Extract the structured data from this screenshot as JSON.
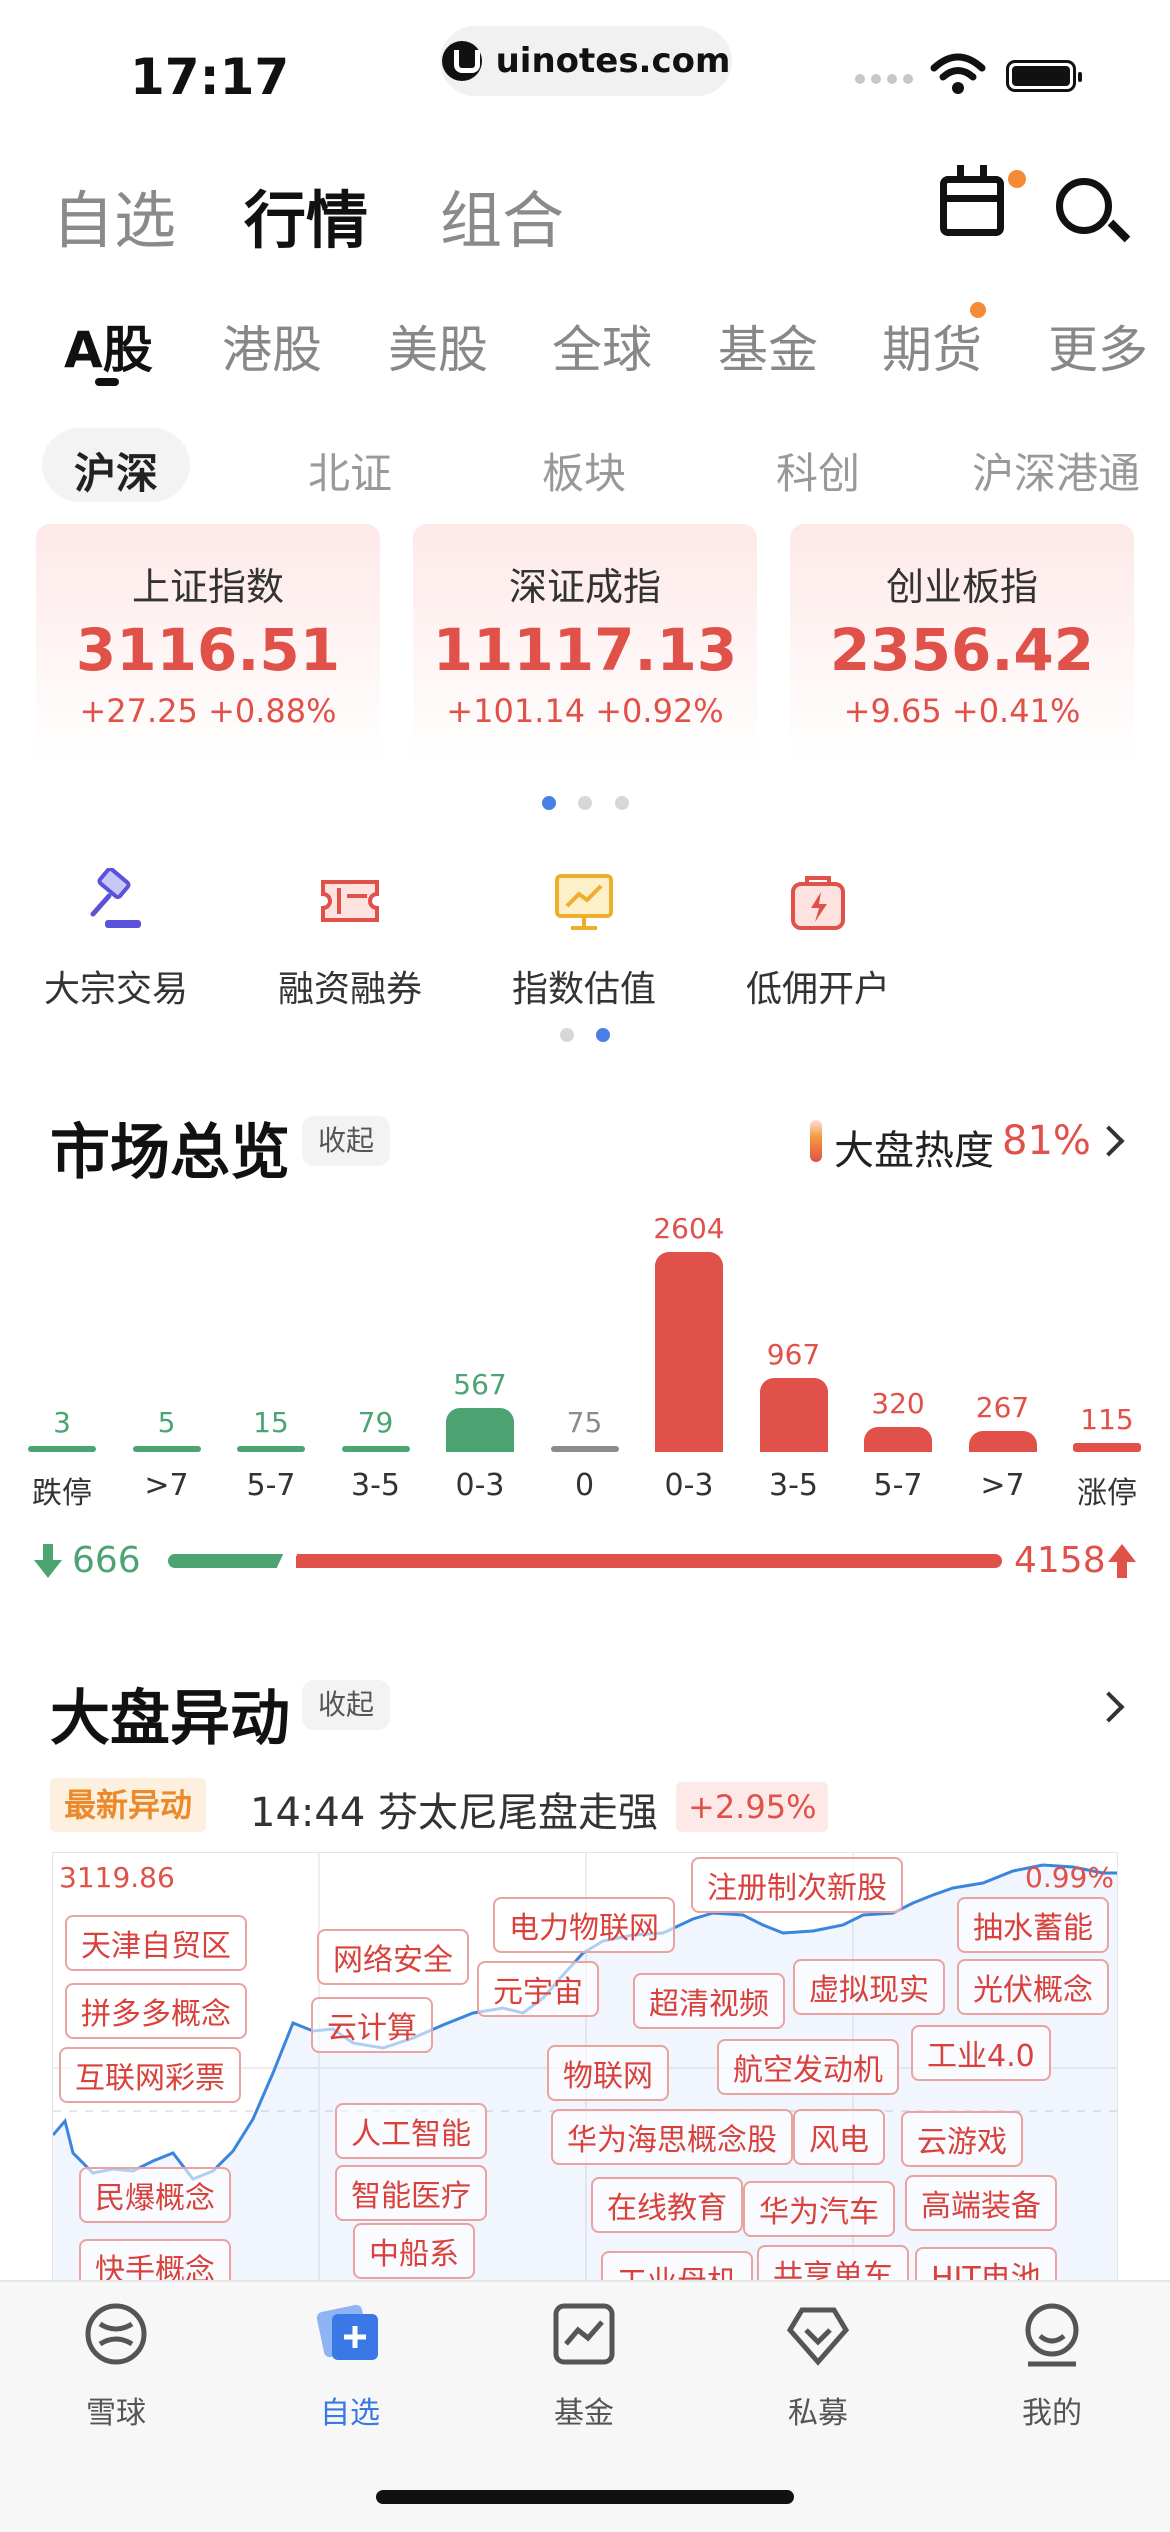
{
  "status_bar": {
    "time": "17:17",
    "url": "uinotes.com"
  },
  "top_tabs": [
    {
      "label": "自选",
      "active": false
    },
    {
      "label": "行情",
      "active": true
    },
    {
      "label": "组合",
      "active": false
    }
  ],
  "market_tabs": [
    {
      "label": "A股",
      "active": true
    },
    {
      "label": "港股"
    },
    {
      "label": "美股"
    },
    {
      "label": "全球"
    },
    {
      "label": "基金"
    },
    {
      "label": "期货",
      "badge": true
    },
    {
      "label": "更多"
    }
  ],
  "sub_tabs": [
    {
      "label": "沪深",
      "active": true
    },
    {
      "label": "北证"
    },
    {
      "label": "板块"
    },
    {
      "label": "科创"
    },
    {
      "label": "沪深港通"
    }
  ],
  "index_cards": [
    {
      "name": "上证指数",
      "value": "3116.51",
      "change": "+27.25 +0.88%"
    },
    {
      "name": "深证成指",
      "value": "11117.13",
      "change": "+101.14 +0.92%"
    },
    {
      "name": "创业板指",
      "value": "2356.42",
      "change": "+9.65 +0.41%"
    }
  ],
  "tools": [
    {
      "label": "大宗交易",
      "icon": "auction-hammer-icon"
    },
    {
      "label": "融资融券",
      "icon": "ticket-icon"
    },
    {
      "label": "指数估值",
      "icon": "chart-board-icon"
    },
    {
      "label": "低佣开户",
      "icon": "lightning-bag-icon"
    }
  ],
  "overview": {
    "title": "市场总览",
    "fold_label": "收起",
    "heat_label": "大盘热度",
    "heat_value": "81%",
    "down_count": "666",
    "up_count": "4158",
    "up_ratio": 0.862
  },
  "chart_data": {
    "type": "bar",
    "title": "",
    "categories": [
      "跌停",
      ">7",
      "5-7",
      "3-5",
      "0-3",
      "0",
      "0-3",
      "3-5",
      "5-7",
      ">7",
      "涨停"
    ],
    "values": [
      3,
      5,
      15,
      79,
      567,
      75,
      2604,
      967,
      320,
      267,
      115
    ],
    "colors": [
      "#4ca472",
      "#4ca472",
      "#4ca472",
      "#4ca472",
      "#4ca472",
      "#8c8c8c",
      "#e0514a",
      "#e0514a",
      "#e0514a",
      "#e0514a",
      "#e0514a"
    ],
    "xlabel": "",
    "ylabel": "",
    "ylim": [
      0,
      2604
    ]
  },
  "movement": {
    "title": "大盘异动",
    "fold_label": "收起",
    "latest_badge": "最新异动",
    "latest_text": "14:44 芬太尼尾盘走强",
    "latest_pct": "+2.95%",
    "high_value": "3119.86",
    "high_pct": "0.99%",
    "tags": [
      "天津自贸区",
      "拼多多概念",
      "互联网彩票",
      "民爆概念",
      "快手概念",
      "网络安全",
      "云计算",
      "人工智能",
      "智能医疗",
      "中船系",
      "电力物联网",
      "元宇宙",
      "物联网",
      "华为海思概念股",
      "在线教育",
      "工业母机",
      "超清视频",
      "注册制次新股",
      "虚拟现实",
      "航空发动机",
      "风电",
      "华为汽车",
      "共享单车",
      "抽水蓄能",
      "光伏概念",
      "工业4.0",
      "云游戏",
      "高端装备",
      "HJT电池"
    ]
  },
  "bottom_tabs": [
    {
      "label": "雪球",
      "icon": "snowball-icon"
    },
    {
      "label": "自选",
      "icon": "watchlist-icon",
      "active": true
    },
    {
      "label": "基金",
      "icon": "fund-chart-icon"
    },
    {
      "label": "私募",
      "icon": "heart-diamond-icon"
    },
    {
      "label": "我的",
      "icon": "profile-icon"
    }
  ]
}
